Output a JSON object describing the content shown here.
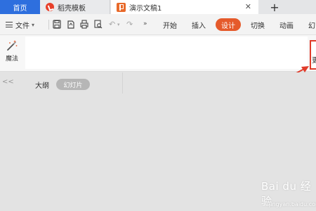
{
  "tabs": {
    "home": "首页",
    "template": "稻壳模板",
    "document": "演示文稿1",
    "close": "✕",
    "new": "+"
  },
  "menu": {
    "file": "文件",
    "items": [
      "开始",
      "插入",
      "设计",
      "切换",
      "动画",
      "幻"
    ],
    "active": "设计"
  },
  "ribbon": {
    "magic_label": "魔法",
    "highlight_partial": "更"
  },
  "panel": {
    "collapse": "<<",
    "outline": "大纲",
    "slides": "幻灯片"
  },
  "watermark": {
    "brand": "Bai du 经验",
    "sub": "jingyan.baidu.com"
  },
  "colors": {
    "accent": "#e55a2b",
    "home_tab": "#2e6fde",
    "callout": "#e03b2a"
  }
}
